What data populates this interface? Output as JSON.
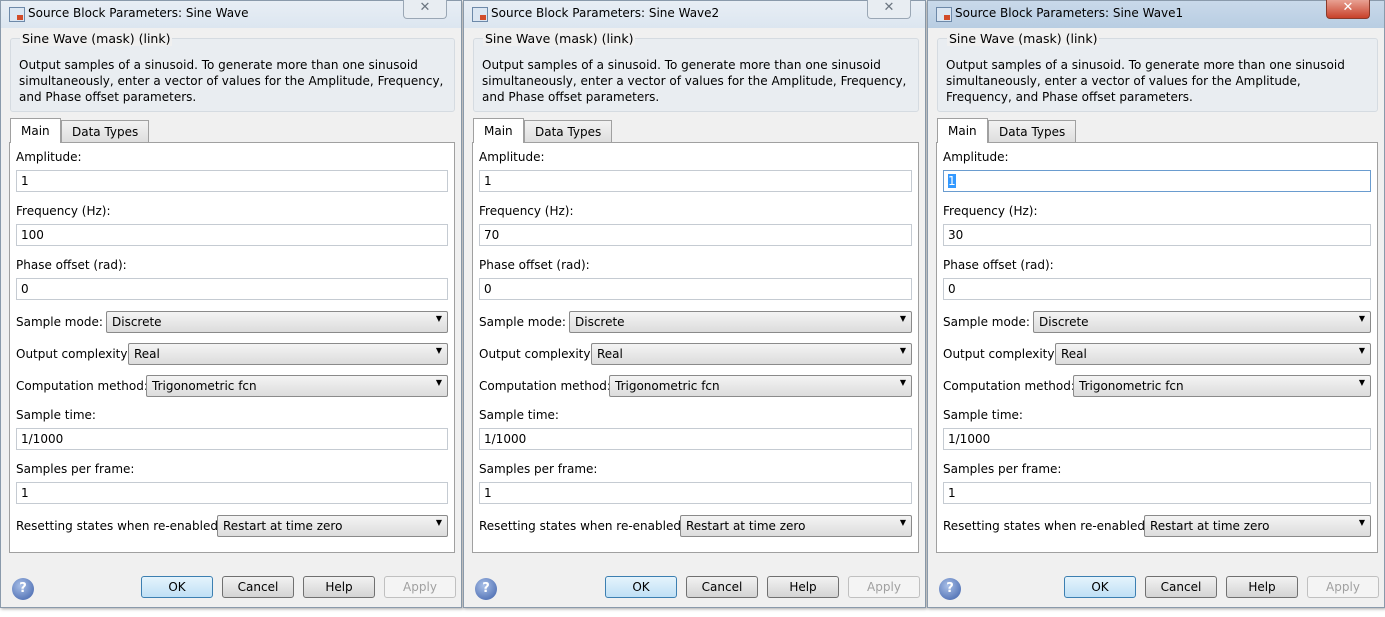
{
  "dialogs": [
    {
      "title": "Source Block Parameters: Sine Wave",
      "active": false,
      "group_label": "Sine Wave (mask) (link)",
      "description": "Output samples of a sinusoid.  To generate more than one sinusoid simultaneously, enter a vector of values for the Amplitude, Frequency, and Phase offset parameters.",
      "tabs": [
        "Main",
        "Data Types"
      ],
      "amplitude_label": "Amplitude:",
      "amplitude": "1",
      "frequency_label": "Frequency (Hz):",
      "frequency": "100",
      "phase_label": "Phase offset (rad):",
      "phase": "0",
      "sample_mode_label": "Sample mode:",
      "sample_mode": "Discrete",
      "output_complexity_label": "Output complexity:",
      "output_complexity": "Real",
      "computation_method_label": "Computation method:",
      "computation_method": "Trigonometric fcn",
      "sample_time_label": "Sample time:",
      "sample_time": "1/1000",
      "samples_per_frame_label": "Samples per frame:",
      "samples_per_frame": "1",
      "resetting_label": "Resetting states when re-enabled:",
      "resetting": "Restart at time zero",
      "buttons": {
        "ok": "OK",
        "cancel": "Cancel",
        "help": "Help",
        "apply": "Apply"
      }
    },
    {
      "title": "Source Block Parameters: Sine Wave2",
      "active": false,
      "group_label": "Sine Wave (mask) (link)",
      "description": "Output samples of a sinusoid.  To generate more than one sinusoid simultaneously, enter a vector of values for the Amplitude, Frequency, and Phase offset parameters.",
      "tabs": [
        "Main",
        "Data Types"
      ],
      "amplitude_label": "Amplitude:",
      "amplitude": "1",
      "frequency_label": "Frequency (Hz):",
      "frequency": "70",
      "phase_label": "Phase offset (rad):",
      "phase": "0",
      "sample_mode_label": "Sample mode:",
      "sample_mode": "Discrete",
      "output_complexity_label": "Output complexity:",
      "output_complexity": "Real",
      "computation_method_label": "Computation method:",
      "computation_method": "Trigonometric fcn",
      "sample_time_label": "Sample time:",
      "sample_time": "1/1000",
      "samples_per_frame_label": "Samples per frame:",
      "samples_per_frame": "1",
      "resetting_label": "Resetting states when re-enabled:",
      "resetting": "Restart at time zero",
      "buttons": {
        "ok": "OK",
        "cancel": "Cancel",
        "help": "Help",
        "apply": "Apply"
      }
    },
    {
      "title": "Source Block Parameters: Sine Wave1",
      "active": true,
      "group_label": "Sine Wave (mask) (link)",
      "description": "Output samples of a sinusoid.  To generate more than one sinusoid simultaneously, enter a vector of values for the Amplitude, Frequency, and Phase offset parameters.",
      "tabs": [
        "Main",
        "Data Types"
      ],
      "amplitude_label": "Amplitude:",
      "amplitude": "1",
      "frequency_label": "Frequency (Hz):",
      "frequency": "30",
      "phase_label": "Phase offset (rad):",
      "phase": "0",
      "sample_mode_label": "Sample mode:",
      "sample_mode": "Discrete",
      "output_complexity_label": "Output complexity:",
      "output_complexity": "Real",
      "computation_method_label": "Computation method:",
      "computation_method": "Trigonometric fcn",
      "sample_time_label": "Sample time:",
      "sample_time": "1/1000",
      "samples_per_frame_label": "Samples per frame:",
      "samples_per_frame": "1",
      "resetting_label": "Resetting states when re-enabled:",
      "resetting": "Restart at time zero",
      "buttons": {
        "ok": "OK",
        "cancel": "Cancel",
        "help": "Help",
        "apply": "Apply"
      }
    }
  ],
  "icons": {
    "close": "✕",
    "dropdown": "▼",
    "help": "?"
  }
}
